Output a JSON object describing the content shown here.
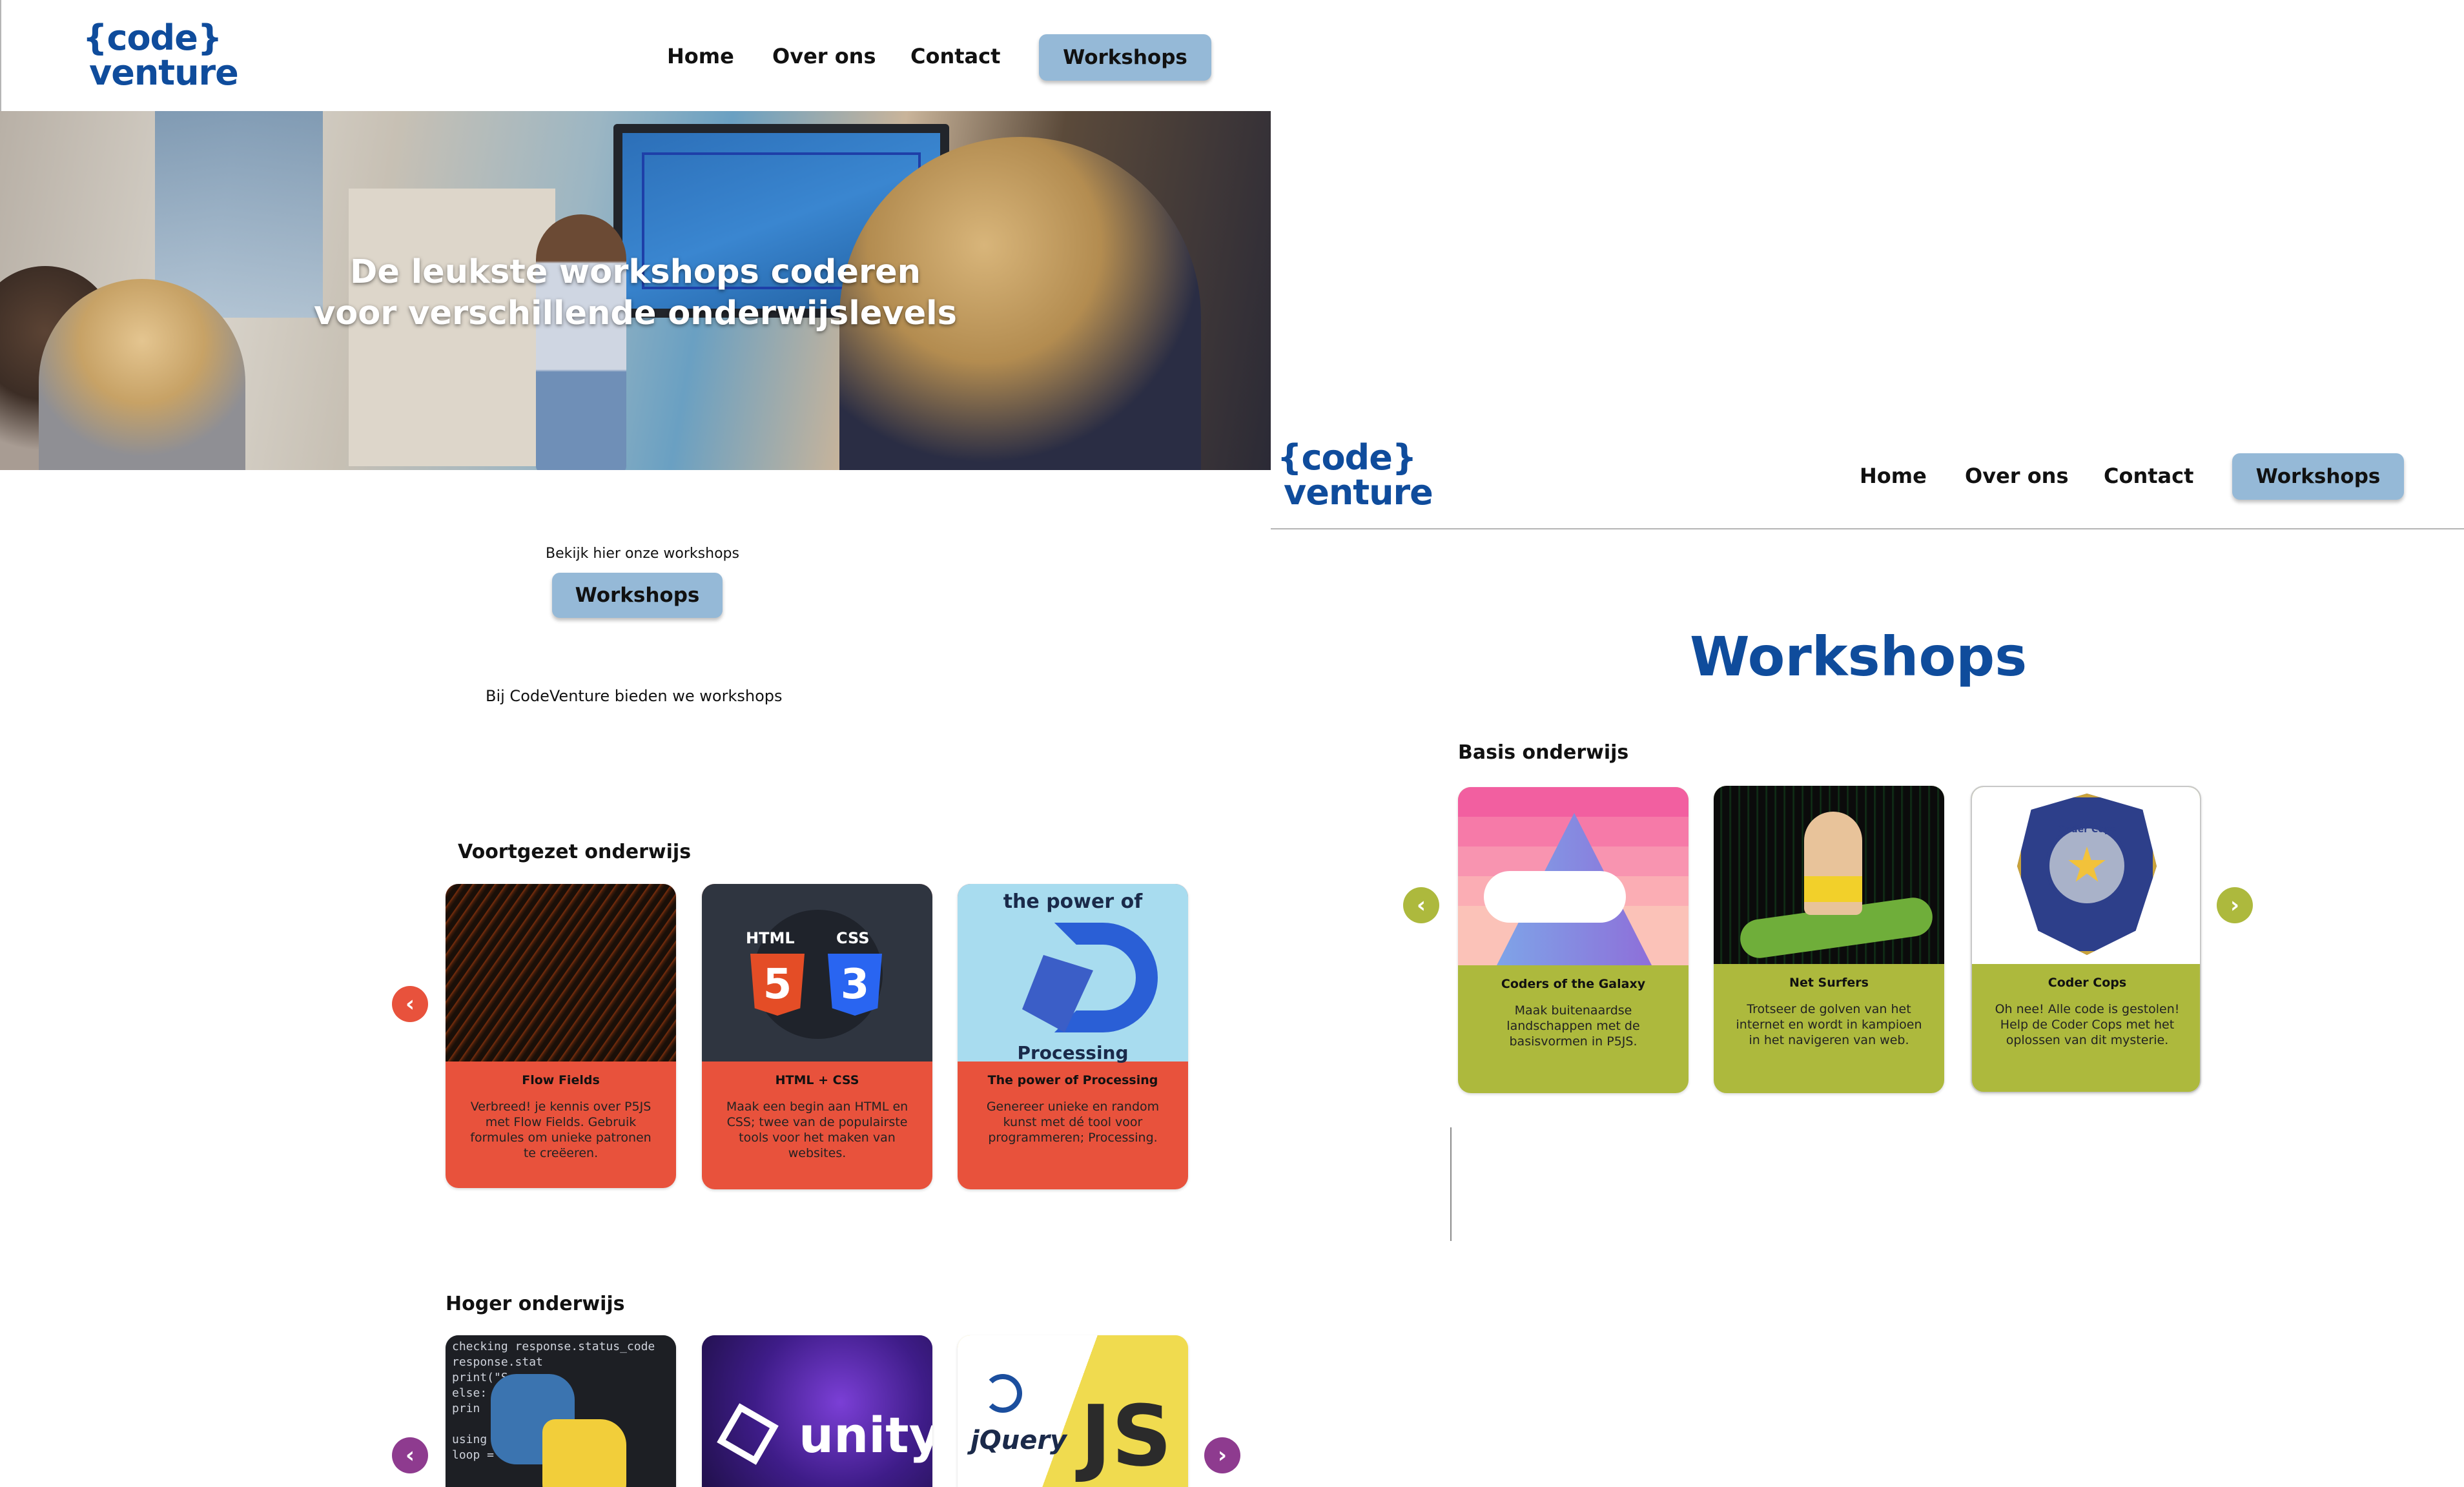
{
  "colors": {
    "brand_blue": "#0f4c9c",
    "nav_button": "#95b9d7",
    "card_red": "#e8523c",
    "card_green": "#adb93d",
    "arrow_red": "#e8523c",
    "arrow_purple": "#8e3b8f",
    "arrow_green": "#adb93d"
  },
  "frame1": {
    "logo": {
      "line1": "{code}",
      "line2": "venture"
    },
    "nav": {
      "home": "Home",
      "about": "Over ons",
      "contact": "Contact",
      "workshops": "Workshops"
    },
    "hero": {
      "line1": "De leukste workshops coderen",
      "line2": "voor verschillende onderwijslevels"
    },
    "intro": {
      "caption": "Bekijk hier onze workshops",
      "button": "Workshops",
      "lead": "Bij CodeVenture bieden we workshops"
    },
    "voortgezet": {
      "title": "Voortgezet onderwijs",
      "cards": [
        {
          "title": "Flow Fields",
          "desc": "Verbreed! je kennis over P5JS met Flow Fields. Gebruik formules om unieke patronen te creëeren."
        },
        {
          "title": "HTML + CSS",
          "desc": "Maak een begin aan HTML en CSS; twee van de populairste tools voor het maken van websites.",
          "badge1": "HTML",
          "badge2": "CSS",
          "num1": "5",
          "num2": "3"
        },
        {
          "title": "The power of Processing",
          "desc": "Genereer unieke en random kunst met dé tool voor programmeren; Processing.",
          "img_top": "the power of",
          "img_bottom": "Processing"
        }
      ]
    },
    "hoger": {
      "title": "Hoger onderwijs",
      "cards": [
        {
          "img_code": "checking response.status_code\nresponse.stat\nprint(\"S\nelse:\nprin\n\nusing\nloop ="
        },
        {
          "img_text": "unity"
        },
        {
          "img_left": "jQuery",
          "img_right": "JS"
        }
      ]
    }
  },
  "frame2": {
    "logo": {
      "line1": "{code}",
      "line2": "venture"
    },
    "nav": {
      "home": "Home",
      "about": "Over ons",
      "contact": "Contact",
      "workshops": "Workshops"
    },
    "heading": "Workshops",
    "basis": {
      "title": "Basis onderwijs",
      "cards": [
        {
          "title": "Coders of the Galaxy",
          "desc": "Maak buitenaardse landschappen met de basisvormen in P5JS."
        },
        {
          "title": "Net Surfers",
          "desc": "Trotseer de golven van het internet en wordt in kampioen in het navigeren van web."
        },
        {
          "title": "Coder Cops",
          "desc": "Oh nee! Alle code is gestolen! Help de Coder Cops met het oplossen van dit mysterie.",
          "badge_text": "Coder Cops"
        }
      ]
    }
  }
}
